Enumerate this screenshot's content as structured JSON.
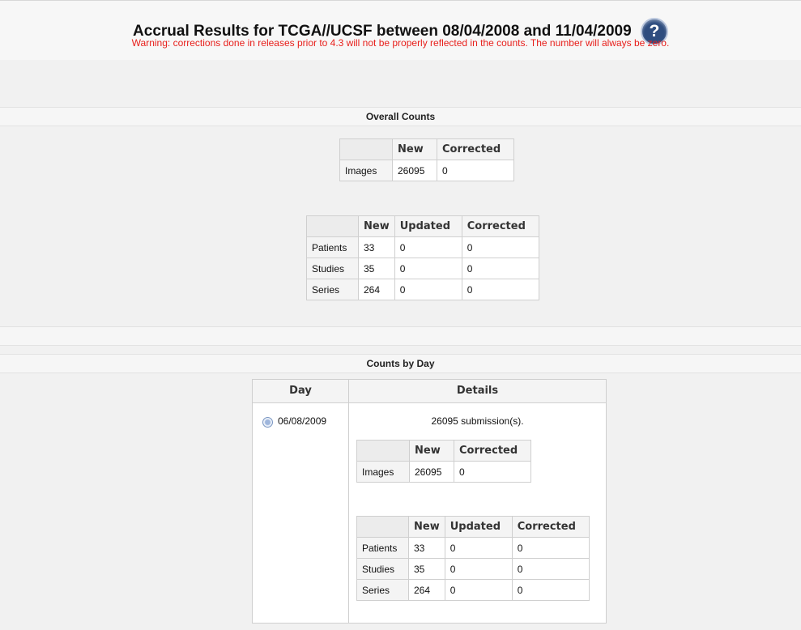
{
  "header": {
    "title": "Accrual Results for TCGA//UCSF between 08/04/2008 and 11/04/2009",
    "help_icon": "question-mark-icon",
    "warning": "Warning: corrections done in releases prior to 4.3 will not be properly reflected in the counts. The number will always be zero."
  },
  "overall": {
    "section_title": "Overall Counts",
    "images_table": {
      "columns": [
        "",
        "New",
        "Corrected"
      ],
      "rows": [
        [
          "Images",
          "26095",
          "0"
        ]
      ]
    },
    "entities_table": {
      "columns": [
        "",
        "New",
        "Updated",
        "Corrected"
      ],
      "rows": [
        [
          "Patients",
          "33",
          "0",
          "0"
        ],
        [
          "Studies",
          "35",
          "0",
          "0"
        ],
        [
          "Series",
          "264",
          "0",
          "0"
        ]
      ]
    }
  },
  "by_day": {
    "section_title": "Counts by Day",
    "day_header": "Day",
    "details_header": "Details",
    "day": "06/08/2009",
    "submissions": "26095 submission(s).",
    "images_table": {
      "columns": [
        "",
        "New",
        "Corrected"
      ],
      "rows": [
        [
          "Images",
          "26095",
          "0"
        ]
      ]
    },
    "entities_table": {
      "columns": [
        "",
        "New",
        "Updated",
        "Corrected"
      ],
      "rows": [
        [
          "Patients",
          "33",
          "0",
          "0"
        ],
        [
          "Studies",
          "35",
          "0",
          "0"
        ],
        [
          "Series",
          "264",
          "0",
          "0"
        ]
      ]
    }
  },
  "colors": {
    "warning": "#e8201c",
    "help_icon": "#2f4d7f"
  }
}
